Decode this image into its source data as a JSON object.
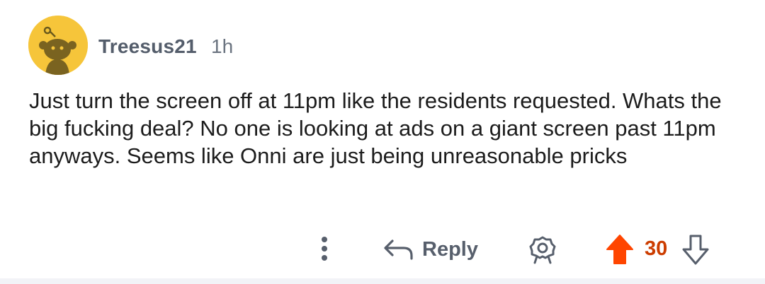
{
  "comment": {
    "author": "Treesus21",
    "age": "1h",
    "avatar_icon": "snoo-avatar-icon",
    "body": "Just turn the screen off at 11pm like the residents requested. Whats the big fucking deal? No one is looking at ads on a giant screen past 11pm anyways. Seems like Onni are just being unreasonable pricks"
  },
  "actions": {
    "more_icon": "more-vertical-icon",
    "reply_icon": "reply-arrow-icon",
    "reply_label": "Reply",
    "award_icon": "award-icon",
    "upvote_icon": "upvote-arrow-icon",
    "score": "30",
    "downvote_icon": "downvote-arrow-icon"
  },
  "colors": {
    "avatar_bg": "#f6c53a",
    "upvoted": "#ff4500",
    "score": "#cc3d00",
    "meta_text": "#545d6b",
    "action_gray": "#575f6c"
  }
}
